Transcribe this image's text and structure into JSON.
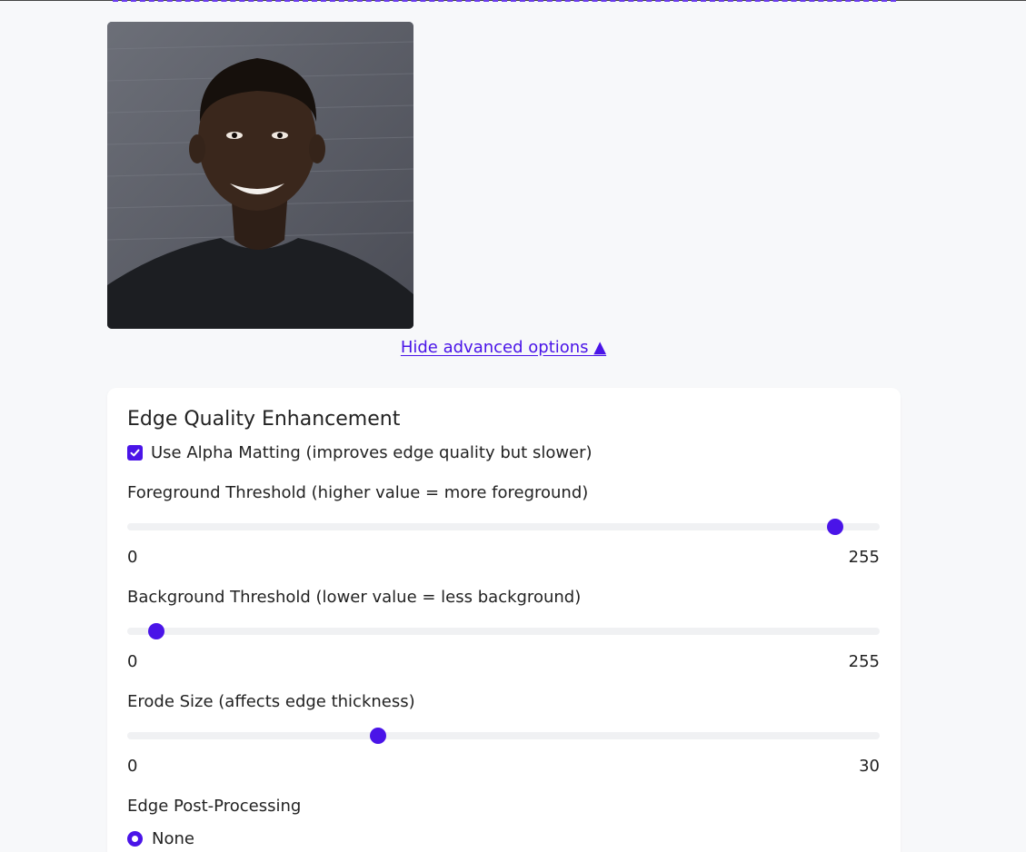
{
  "toggle_link": {
    "label": "Hide advanced options ▲"
  },
  "photo": {
    "alt": "Uploaded portrait photo"
  },
  "edge_card": {
    "title": "Edge Quality Enhancement",
    "alpha_matting": {
      "label": "Use Alpha Matting (improves edge quality but slower)",
      "checked": true
    },
    "foreground_threshold": {
      "label": "Foreground Threshold (higher value = more foreground)",
      "min": "0",
      "max": "255",
      "value": 240
    },
    "background_threshold": {
      "label": "Background Threshold (lower value = less background)",
      "min": "0",
      "max": "255",
      "value": 10
    },
    "erode_size": {
      "label": "Erode Size (affects edge thickness)",
      "min": "0",
      "max": "30",
      "value": 10
    },
    "post_processing": {
      "label": "Edge Post-Processing",
      "options": [
        {
          "label": "None",
          "selected": true
        }
      ]
    }
  },
  "colors": {
    "accent": "#4a14e8",
    "background": "#f7f8fa",
    "card": "#ffffff"
  },
  "icons": {
    "checkbox": "check-icon",
    "radio": "radio-selected-icon"
  }
}
